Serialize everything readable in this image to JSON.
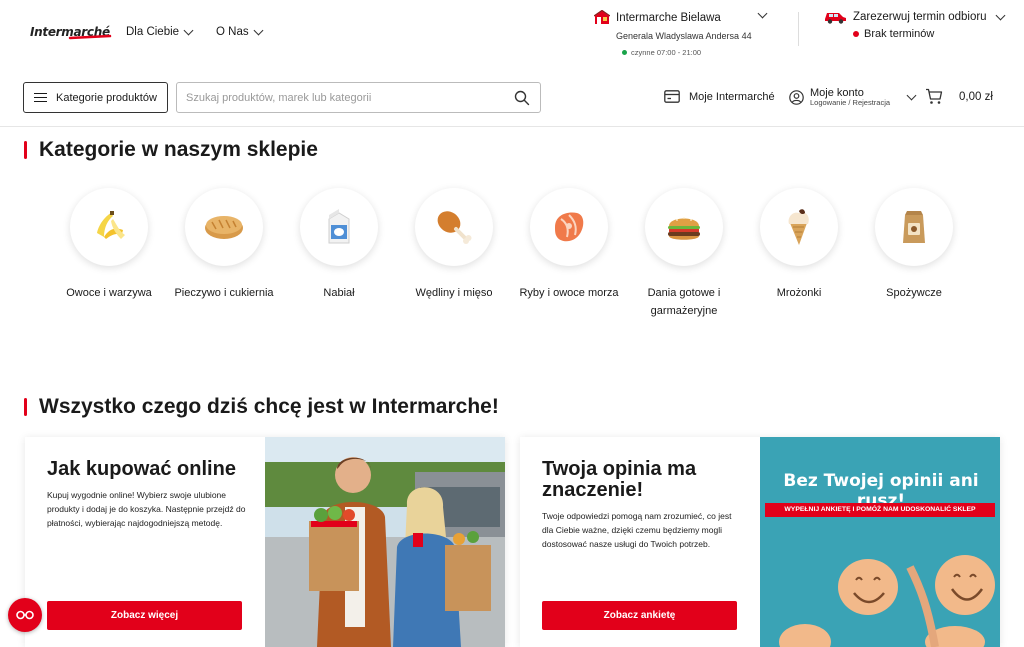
{
  "header": {
    "logo_text": "Intermarché",
    "nav": [
      {
        "label": "Dla Ciebie"
      },
      {
        "label": "O Nas"
      }
    ],
    "store": {
      "name": "Intermarche Bielawa",
      "address": "Generala Wladyslawa Andersa 44",
      "hours": "czynne 07:00 - 21:00"
    },
    "pickup": {
      "title": "Zarezerwuj termin odbioru",
      "status": "Brak terminów"
    }
  },
  "toolbar": {
    "categories_label": "Kategorie produktów",
    "search_placeholder": "Szukaj produktów, marek lub kategorii",
    "moje_label": "Moje Intermarché",
    "account_label": "Moje konto",
    "account_sub": "Logowanie / Rejestracja",
    "cart_total": "0,00 zł"
  },
  "categories_section": {
    "title": "Kategorie w naszym sklepie",
    "items": [
      {
        "label": "Owoce i warzywa",
        "icon": "banana-icon"
      },
      {
        "label": "Pieczywo i cukiernia",
        "icon": "bread-icon"
      },
      {
        "label": "Nabiał",
        "icon": "milk-carton-icon"
      },
      {
        "label": "Wędliny i mięso",
        "icon": "drumstick-icon"
      },
      {
        "label": "Ryby i owoce morza",
        "icon": "fish-steak-icon"
      },
      {
        "label": "Dania gotowe i garmażeryjne",
        "icon": "burger-icon"
      },
      {
        "label": "Mrożonki",
        "icon": "ice-cream-icon"
      },
      {
        "label": "Spożywcze",
        "icon": "grocery-bag-icon"
      }
    ]
  },
  "promo_section": {
    "title": "Wszystko czego dziś chcę jest w Intermarche!",
    "cards": [
      {
        "title": "Jak kupować online",
        "desc": "Kupuj wygodnie online! Wybierz swoje ulubione produkty i dodaj je do koszyka. Następnie przejdź do płatności, wybierając najdogodniejszą metodę.",
        "button": "Zobacz więcej"
      },
      {
        "title": "Twoja opinia ma znaczenie!",
        "desc": "Twoje odpowiedzi pomogą nam zrozumieć, co jest dla Ciebie ważne, dzięki czemu będziemy mogli dostosować nasze usługi do Twoich potrzeb.",
        "button": "Zobacz ankietę",
        "banner_title": "Bez Twojej opinii ani rusz!",
        "banner_sub": "WYPEŁNIJ ANKIETĘ I POMÓŻ NAM UDOSKONALIĆ SKLEP"
      }
    ]
  },
  "colors": {
    "brand_red": "#e2001a",
    "open_green": "#19a34a"
  }
}
